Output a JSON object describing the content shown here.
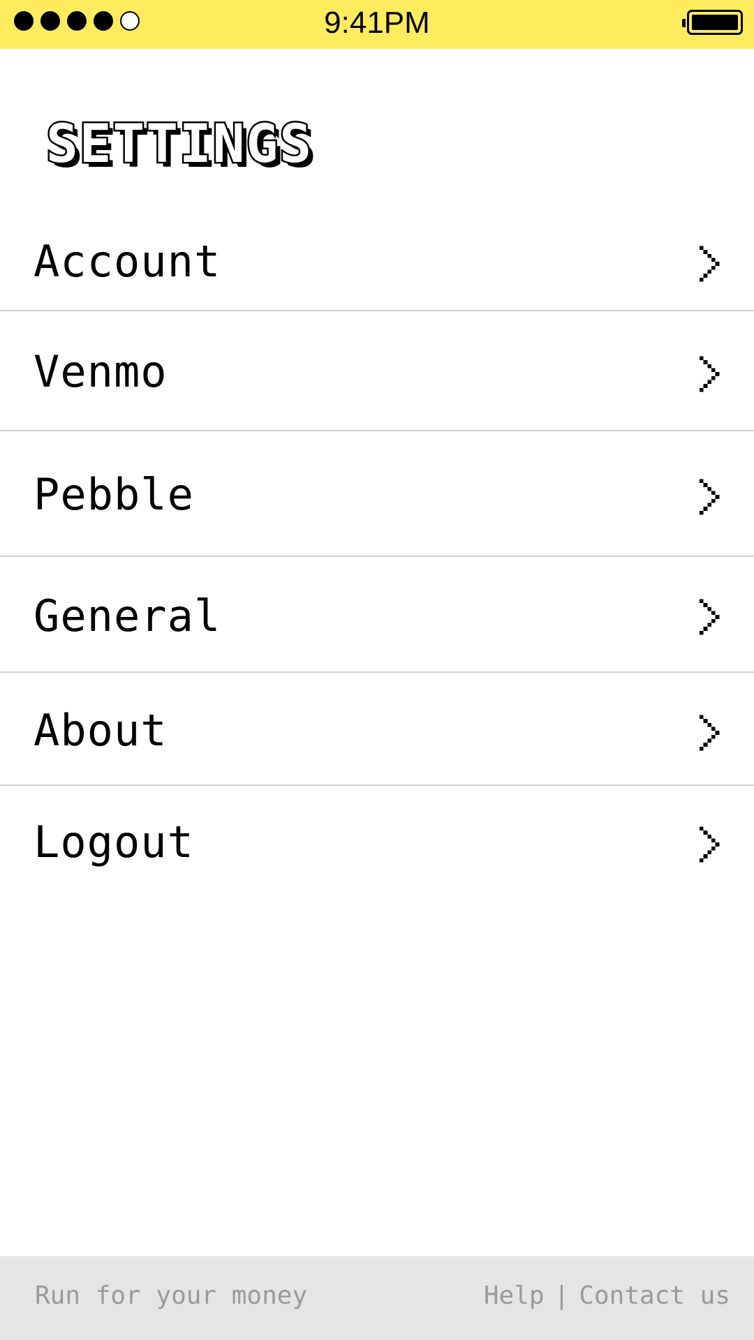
{
  "colors": {
    "status_bar_bg": "#ffec5e",
    "background": "#ffffff",
    "text": "#000000",
    "divider": "#cfcfcf",
    "footer_bg": "#e5e5e5",
    "footer_text": "#9a9a9a"
  },
  "status_bar": {
    "time": "9:41PM",
    "signal_bars_filled": 4,
    "signal_bars_total": 5,
    "battery_icon": "battery-full-icon"
  },
  "title": "SETTINGS",
  "menu": {
    "items": [
      {
        "label": "Account",
        "icon": "chevron-right-icon"
      },
      {
        "label": "Venmo",
        "icon": "chevron-right-icon"
      },
      {
        "label": "Pebble",
        "icon": "chevron-right-icon"
      },
      {
        "label": "General",
        "icon": "chevron-right-icon"
      },
      {
        "label": "About",
        "icon": "chevron-right-icon"
      },
      {
        "label": "Logout",
        "icon": "chevron-right-icon"
      }
    ]
  },
  "footer": {
    "tagline": "Run for your money",
    "help_link": "Help",
    "separator": "|",
    "contact_link": "Contact us"
  }
}
